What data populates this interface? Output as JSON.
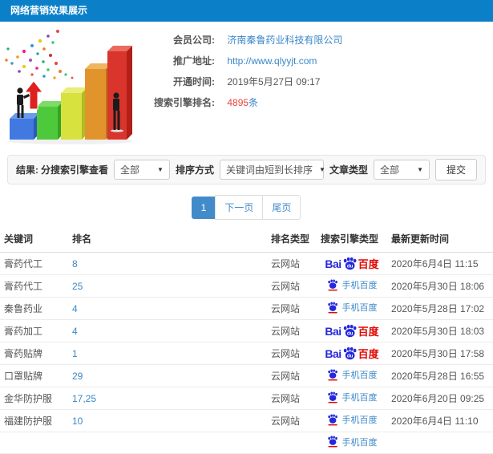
{
  "window": {
    "title": "网络营销效果展示"
  },
  "info": {
    "rows": [
      {
        "label": "会员公司:",
        "value": "济南秦鲁药业科技有限公司",
        "type": "link"
      },
      {
        "label": "推广地址:",
        "value": "http://www.qlyyjt.com",
        "type": "link"
      },
      {
        "label": "开通时间:",
        "value": "2019年5月27日 09:17",
        "type": "text"
      },
      {
        "label": "搜索引擎排名:",
        "value": "4895",
        "suffix": "条",
        "type": "highlight"
      }
    ]
  },
  "filters": {
    "result_label": "结果:",
    "engine_label": "分搜索引擎查看",
    "engine_value": "全部",
    "sort_label": "排序方式",
    "sort_value": "关键词由短到长排序",
    "article_label": "文章类型",
    "article_value": "全部",
    "submit_label": "提交",
    "caret": "▼"
  },
  "pagination": {
    "pages": [
      {
        "label": "1",
        "active": true
      },
      {
        "label": "下一页",
        "active": false
      },
      {
        "label": "尾页",
        "active": false
      }
    ]
  },
  "table": {
    "headers": [
      "关键词",
      "排名",
      "排名类型",
      "搜索引擎类型",
      "最新更新时间"
    ],
    "branding": {
      "baidu_latin": "Bai",
      "baidu_du": "du",
      "baidu_cn": "百度",
      "mobile_cn": "手机百度"
    },
    "rows": [
      {
        "keyword": "膏药代工",
        "rank": "8",
        "rank_type": "云网站",
        "engine": "baidu",
        "updated": "2020年6月4日 11:15"
      },
      {
        "keyword": "膏药代工",
        "rank": "25",
        "rank_type": "云网站",
        "engine": "mobile",
        "updated": "2020年5月30日 18:06"
      },
      {
        "keyword": "秦鲁药业",
        "rank": "4",
        "rank_type": "云网站",
        "engine": "mobile",
        "updated": "2020年5月28日 17:02"
      },
      {
        "keyword": "膏药加工",
        "rank": "4",
        "rank_type": "云网站",
        "engine": "baidu",
        "updated": "2020年5月30日 18:03"
      },
      {
        "keyword": "膏药贴牌",
        "rank": "1",
        "rank_type": "云网站",
        "engine": "baidu",
        "updated": "2020年5月30日 17:58"
      },
      {
        "keyword": "口罩贴牌",
        "rank": "29",
        "rank_type": "云网站",
        "engine": "mobile",
        "updated": "2020年5月28日 16:55"
      },
      {
        "keyword": "金华防护服",
        "rank": "17,25",
        "rank_type": "云网站",
        "engine": "mobile",
        "updated": "2020年6月20日 09:25"
      },
      {
        "keyword": "福建防护服",
        "rank": "10",
        "rank_type": "云网站",
        "engine": "mobile",
        "updated": "2020年6月4日 11:10"
      },
      {
        "keyword": "",
        "rank": "",
        "rank_type": "",
        "engine": "mobile",
        "updated": ""
      }
    ]
  },
  "colors": {
    "titlebar_bg": "#0b80c8",
    "link_blue": "#3a87c8",
    "accent_red": "#e8443f",
    "baidu_blue": "#2529dc",
    "baidu_red": "#e10601",
    "pagination_active": "#428bca"
  }
}
